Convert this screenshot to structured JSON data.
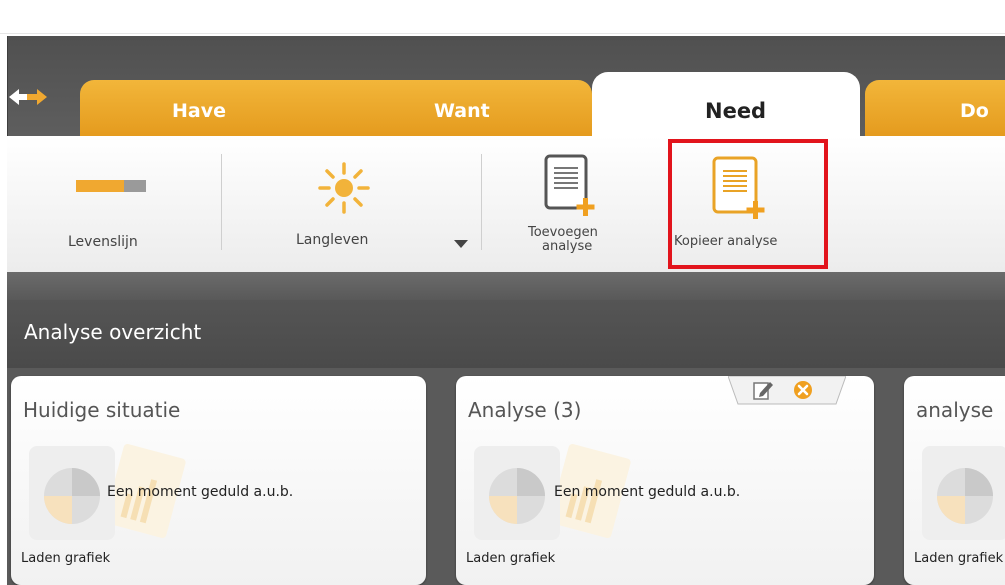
{
  "tabs": [
    {
      "label": "Have",
      "active": false
    },
    {
      "label": "Want",
      "active": false
    },
    {
      "label": "Need",
      "active": true
    },
    {
      "label": "Do",
      "active": false
    }
  ],
  "ribbon": {
    "lifeline_label": "Levenslijn",
    "scenario_label": "Langleven",
    "add_analysis_label_line1": "Toevoegen",
    "add_analysis_label_line2": "analyse",
    "copy_analysis_label": "Kopieer analyse"
  },
  "section": {
    "title": "Analyse overzicht"
  },
  "cards": [
    {
      "title": "Huidige situatie",
      "message": "Een moment geduld a.u.b.",
      "footer": "Laden grafiek"
    },
    {
      "title": "Analyse (3)",
      "message": "Een moment geduld a.u.b.",
      "footer": "Laden grafiek"
    },
    {
      "title": "analyse",
      "message": "",
      "footer": "Laden grafiek"
    }
  ],
  "colors": {
    "tab_orange": "#eba42a",
    "accent_icon": "#e9a326",
    "highlight": "#e2141c",
    "dark_bg": "#555555"
  },
  "icons": [
    "back-arrow-icon",
    "lifeline-icon",
    "sun-icon",
    "dropdown-arrow-icon",
    "add-document-icon",
    "copy-document-icon",
    "edit-icon",
    "close-icon",
    "chart-placeholder-icon"
  ]
}
